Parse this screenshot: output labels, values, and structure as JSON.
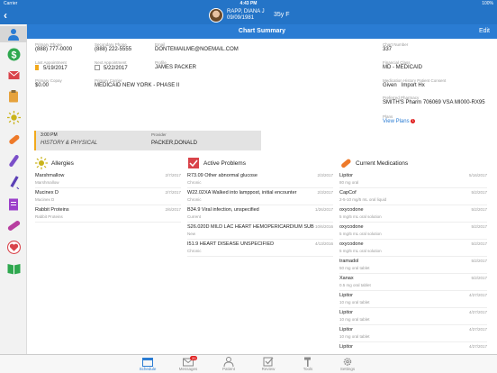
{
  "status": {
    "carrier": "Carrier",
    "time": "4:43 PM",
    "battery": "100%"
  },
  "patient": {
    "name": "RAPP, DIANA J",
    "dob": "09/09/1981",
    "age_sex": "35y F",
    "back": "‹"
  },
  "titlebar": {
    "title": "Chart Summary",
    "edit": "Edit"
  },
  "summary": {
    "primary_phone": {
      "label": "Primary Phone",
      "value": "(888) 777-0000"
    },
    "secondary_phone": {
      "label": "Secondary Phone",
      "value": "(888) 222-5555"
    },
    "email": {
      "label": "Email",
      "value": "DONTEMAILME@NOEMAIL.COM"
    },
    "chart_number": {
      "label": "Chart Number",
      "value": "337"
    },
    "last_appointment": {
      "label": "Last Appointment",
      "value": "5/19/2017"
    },
    "next_appointment": {
      "label": "Next Appointment",
      "value": "5/22/2017"
    },
    "profile": {
      "label": "Profile",
      "value": "JAMES PACKER"
    },
    "financial_class": {
      "label": "Financial Class",
      "value": "MD - MEDICAID"
    },
    "primary_copay": {
      "label": "Primary Copay",
      "value": "$0.00"
    },
    "primary_carrier": {
      "label": "Primary Carrier",
      "value": "MEDICAID NEW YORK - PHASE II"
    },
    "med_history": {
      "label": "Medication History Patient Consent",
      "value1": "Given",
      "value2": "Import Hx"
    },
    "preferred_pharmacy": {
      "label": "Preferred Pharmacy",
      "value": "SMITH'S Pharm 706069 VSA MI000-RX95"
    },
    "plans": {
      "label": "Plans",
      "value": "View Plans",
      "badge": "1"
    }
  },
  "appointment": {
    "time": "3:00 PM",
    "description": "HISTORY & PHYSICAL",
    "provider_label": "Provider",
    "provider": "PACKER,DONALD"
  },
  "allergies": {
    "title": "Allergies",
    "items": [
      {
        "name": "Marshmallow",
        "sub": "Marshmallow",
        "date": "2/7/2017"
      },
      {
        "name": "Mucinex D",
        "sub": "Mucinex D",
        "date": "2/7/2017"
      },
      {
        "name": "Rabbit Proteins",
        "sub": "Rabbit Proteins",
        "date": "2/6/2017"
      }
    ]
  },
  "problems": {
    "title": "Active Problems",
    "items": [
      {
        "name": "R73.09 Other abnormal glucose",
        "sub": "Chronic",
        "date": "2/3/2017"
      },
      {
        "name": "W22.02XA Walked into lamppost, initial encounter",
        "sub": "Chronic",
        "date": "2/3/2017"
      },
      {
        "name": "B34.9 Viral infection, unspecified",
        "sub": "Current",
        "date": "1/26/2017"
      },
      {
        "name": "S26.020D MILD LAC HEART HEMOPERICARDIUM SUB",
        "sub": "New",
        "date": "10/6/2016"
      },
      {
        "name": "I51.9 HEART DISEASE UNSPECIFIED",
        "sub": "Chronic",
        "date": "4/13/2016"
      }
    ]
  },
  "medications": {
    "title": "Current Medications",
    "items": [
      {
        "name": "Lipitor",
        "sub": "80 mg oral",
        "date": "5/16/2017"
      },
      {
        "name": "CapCof",
        "sub": "2-5-10 mg/5 mL oral liquid",
        "date": "5/2/2017"
      },
      {
        "name": "oxycodone",
        "sub": "5 mg/5 mL oral solution",
        "date": "5/2/2017"
      },
      {
        "name": "oxycodone",
        "sub": "5 mg/5 mL oral solution",
        "date": "5/2/2017"
      },
      {
        "name": "oxycodone",
        "sub": "5 mg/5 mL oral solution",
        "date": "5/2/2017"
      },
      {
        "name": "tramadol",
        "sub": "50 mg oral tablet",
        "date": "5/2/2017"
      },
      {
        "name": "Xanax",
        "sub": "0.5 mg oral tablet",
        "date": "5/2/2017"
      },
      {
        "name": "Lipitor",
        "sub": "10 mg oral tablet",
        "date": "4/27/2017"
      },
      {
        "name": "Lipitor",
        "sub": "10 mg oral tablet",
        "date": "4/27/2017"
      },
      {
        "name": "Lipitor",
        "sub": "10 mg oral tablet",
        "date": "4/27/2017"
      },
      {
        "name": "Lipitor",
        "sub": "",
        "date": "4/27/2017"
      }
    ]
  },
  "tabs": [
    {
      "label": "Schedule",
      "icon": "calendar-icon"
    },
    {
      "label": "Messages",
      "icon": "envelope-icon",
      "badge": "20"
    },
    {
      "label": "Patient",
      "icon": "person-icon"
    },
    {
      "label": "Review",
      "icon": "checkbox-icon"
    },
    {
      "label": "Tools",
      "icon": "hammer-icon"
    },
    {
      "label": "Settings",
      "icon": "gear-icon"
    }
  ],
  "colors": {
    "accent": "#2a7cd3",
    "header": "#2474c7",
    "alert": "#e02020",
    "appointment_marker": "#f2a91c"
  }
}
